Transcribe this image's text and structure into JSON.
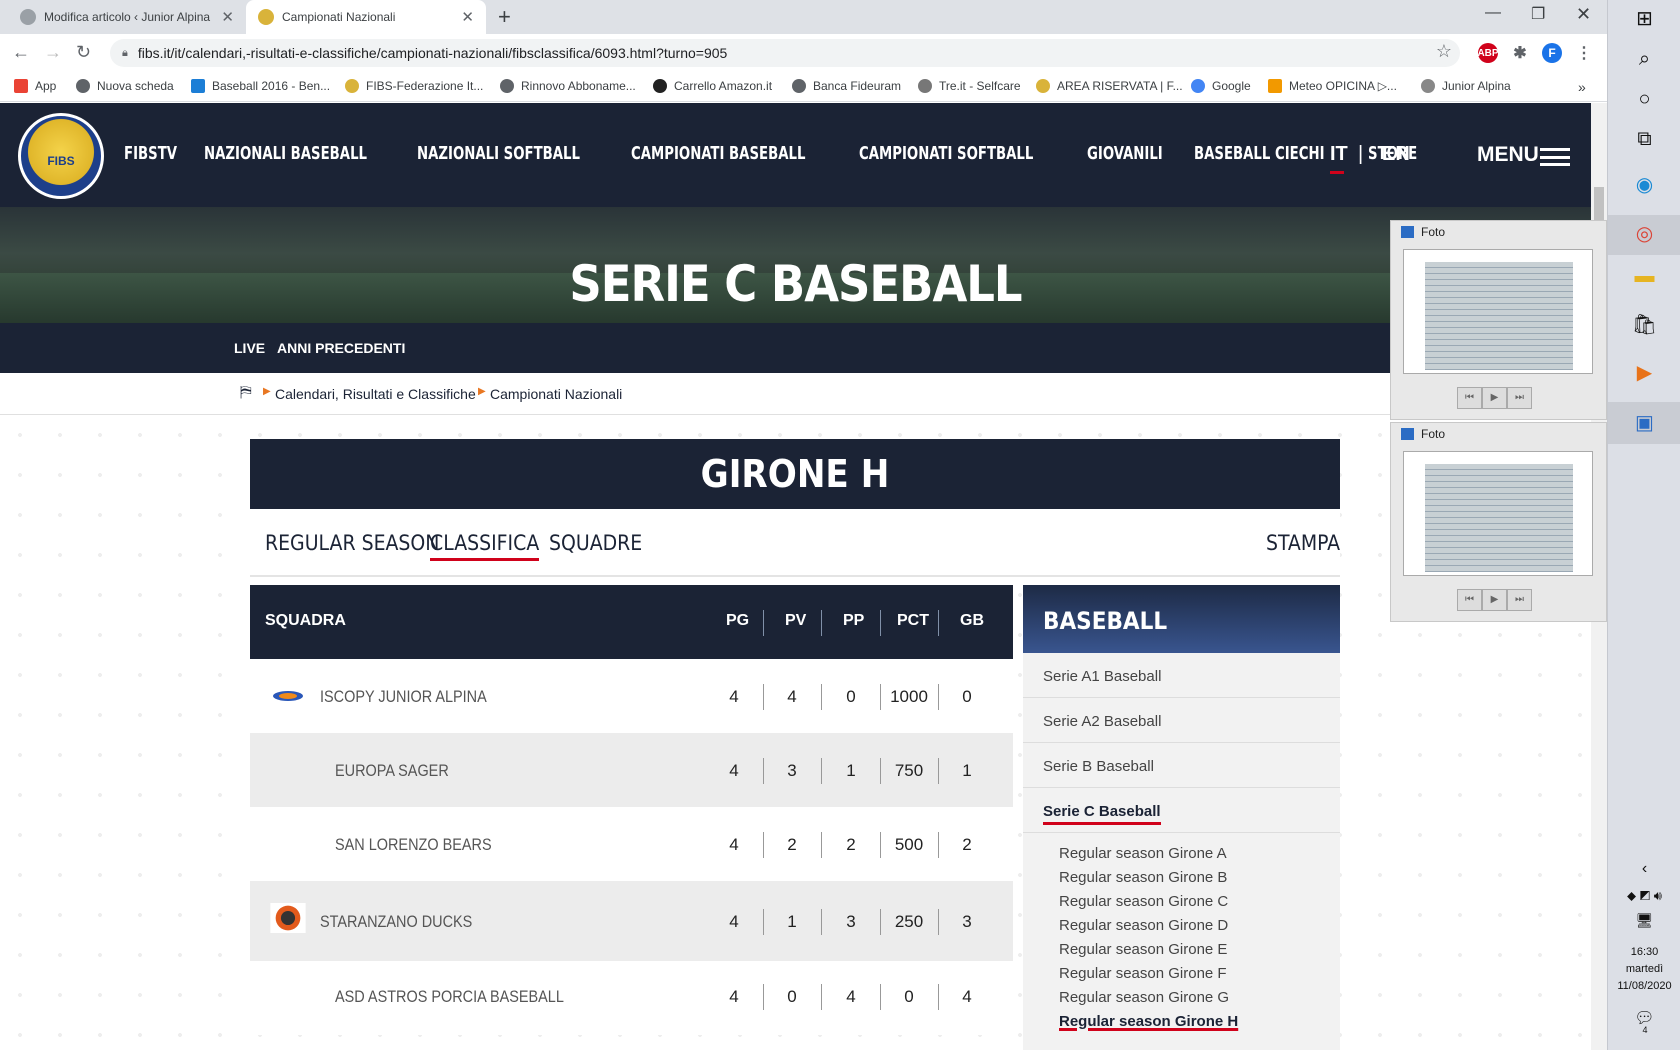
{
  "browser": {
    "tabs": [
      {
        "title": "Modifica articolo ‹ Junior Alpina"
      },
      {
        "title": "Campionati Nazionali"
      }
    ],
    "url": "fibs.it/it/calendari,-risultati-e-classifiche/campionati-nazionali/fibsclassifica/6093.html?turno=905",
    "profile_initial": "F",
    "abp_label": "ABP",
    "bookmarks": [
      "App",
      "Nuova scheda",
      "Baseball 2016 - Ben...",
      "FIBS-Federazione It...",
      "Rinnovo Abboname...",
      "Carrello Amazon.it",
      "Banca Fideuram",
      "Tre.it - Selfcare",
      "AREA RISERVATA | F...",
      "Google",
      "Meteo OPICINA ▷...",
      "Junior Alpina"
    ]
  },
  "site": {
    "logo_text": "FIBS",
    "nav": [
      "FIBSTV",
      "NAZIONALI BASEBALL",
      "NAZIONALI SOFTBALL",
      "CAMPIONATI BASEBALL",
      "CAMPIONATI SOFTBALL",
      "GIOVANILI",
      "BASEBALL CIECHI",
      "STORE"
    ],
    "lang": {
      "it": "IT",
      "sep": "|",
      "en": "EN"
    },
    "menu": "MENU",
    "hero_title": "SERIE C BASEBALL",
    "subnav": [
      "LIVE",
      "ANNI PRECEDENTI"
    ],
    "breadcrumb": [
      "Calendari, Risultati e Classifiche",
      "Campionati Nazionali"
    ],
    "girone_title": "GIRONE H",
    "tabs": [
      "REGULAR SEASON",
      "CLASSIFICA",
      "SQUADRE"
    ],
    "print_label": "STAMPA",
    "table": {
      "headers": [
        "SQUADRA",
        "PG",
        "PV",
        "PP",
        "PCT",
        "GB"
      ],
      "rows": [
        {
          "team": "ISCOPY JUNIOR ALPINA",
          "pg": "4",
          "pv": "4",
          "pp": "0",
          "pct": "1000",
          "gb": "0"
        },
        {
          "team": "EUROPA SAGER",
          "pg": "4",
          "pv": "3",
          "pp": "1",
          "pct": "750",
          "gb": "1"
        },
        {
          "team": "SAN LORENZO BEARS",
          "pg": "4",
          "pv": "2",
          "pp": "2",
          "pct": "500",
          "gb": "2"
        },
        {
          "team": "STARANZANO DUCKS",
          "pg": "4",
          "pv": "1",
          "pp": "3",
          "pct": "250",
          "gb": "3"
        },
        {
          "team": "ASD ASTROS PORCIA BASEBALL",
          "pg": "4",
          "pv": "0",
          "pp": "4",
          "pct": "0",
          "gb": "4"
        }
      ]
    },
    "sidebar": {
      "title": "BASEBALL",
      "items": [
        "Serie A1 Baseball",
        "Serie A2 Baseball",
        "Serie B Baseball",
        "Serie C Baseball"
      ],
      "subitems": [
        "Regular season Girone A",
        "Regular season Girone B",
        "Regular season Girone C",
        "Regular season Girone D",
        "Regular season Girone E",
        "Regular season Girone F",
        "Regular season Girone G",
        "Regular season Girone H"
      ]
    }
  },
  "photos": [
    {
      "title": "Foto"
    },
    {
      "title": "Foto"
    }
  ],
  "taskbar": {
    "time": "16:30",
    "day": "martedì",
    "date": "11/08/2020",
    "notif_count": "4"
  }
}
